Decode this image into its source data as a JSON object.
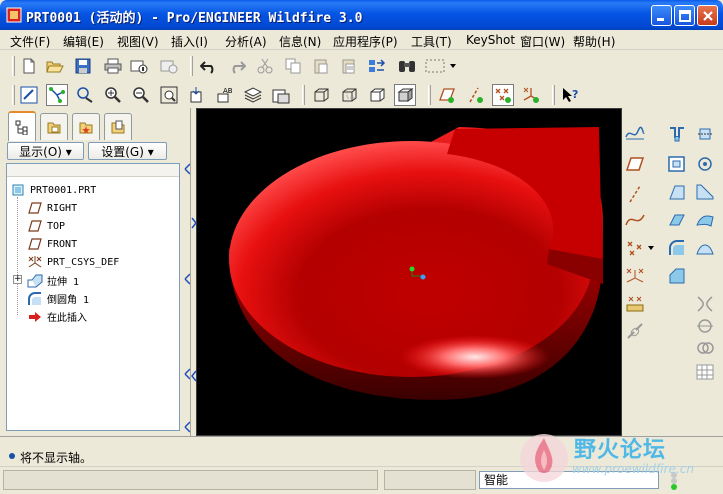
{
  "window": {
    "title": "PRT0001 (活动的) - Pro/ENGINEER Wildfire 3.0"
  },
  "menu": [
    {
      "label": "文件(F)"
    },
    {
      "label": "编辑(E)"
    },
    {
      "label": "视图(V)"
    },
    {
      "label": "插入(I)"
    },
    {
      "label": "分析(A)"
    },
    {
      "label": "信息(N)"
    },
    {
      "label": "应用程序(P)"
    },
    {
      "label": "工具(T)"
    },
    {
      "label": "KeyShot"
    },
    {
      "label": "窗口(W)"
    },
    {
      "label": "帮助(H)"
    }
  ],
  "navigator": {
    "show_button": "显示(O) ▾",
    "settings_button": "设置(G) ▾"
  },
  "model_tree": {
    "root": "PRT0001.PRT",
    "items": [
      {
        "label": "RIGHT",
        "icon": "datum-plane-icon"
      },
      {
        "label": "TOP",
        "icon": "datum-plane-icon"
      },
      {
        "label": "FRONT",
        "icon": "datum-plane-icon"
      },
      {
        "label": "PRT_CSYS_DEF",
        "icon": "csys-icon"
      },
      {
        "label": "拉伸 1",
        "icon": "extrude-icon"
      },
      {
        "label": "倒圆角 1",
        "icon": "round-icon"
      },
      {
        "label": "在此插入",
        "icon": "insert-here-arrow-icon"
      }
    ]
  },
  "status": {
    "message": "将不显示轴。",
    "filter": "智能"
  },
  "watermark": {
    "text": "野火论坛",
    "url": "www.proewildfire.cn"
  },
  "colors": {
    "model_red": "#D40000",
    "xp_title_blue": "#0A5BEA",
    "background_black": "#000000"
  }
}
